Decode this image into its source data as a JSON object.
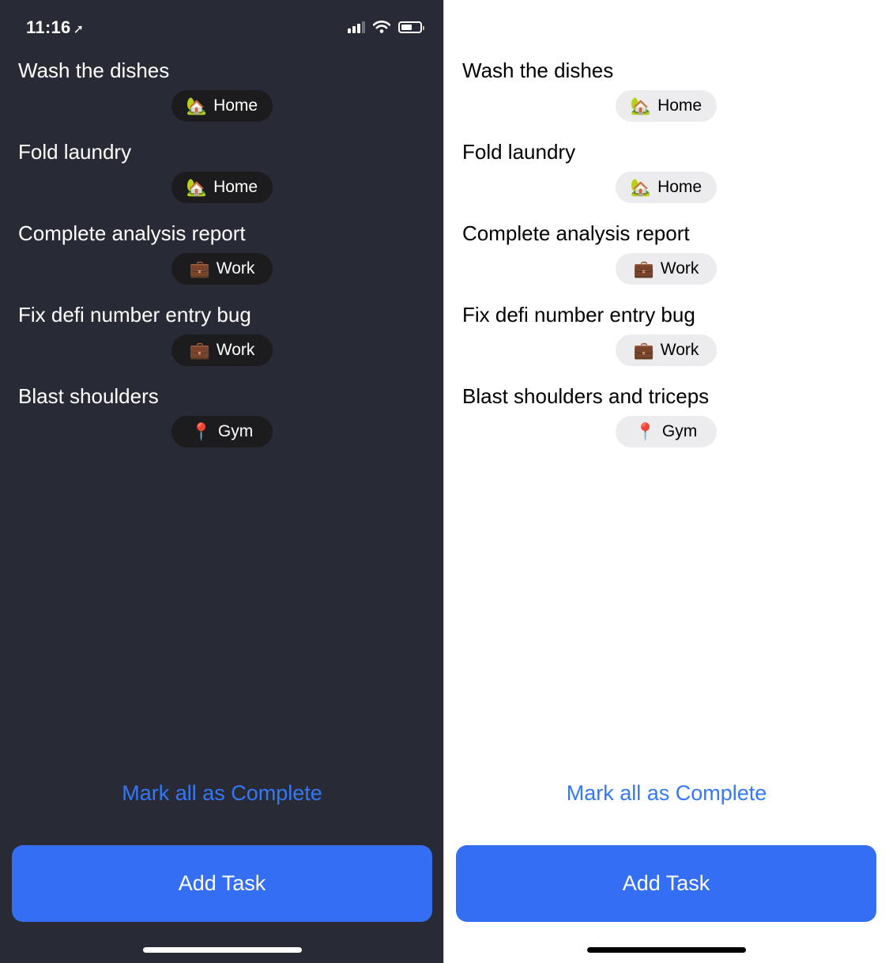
{
  "status_bar": {
    "time": "11:16",
    "location_icon": "location-arrow-icon",
    "signal_icon": "cellular-signal-icon",
    "wifi_icon": "wifi-icon",
    "battery_icon": "battery-icon"
  },
  "screens": [
    {
      "theme": "dark",
      "tasks": [
        {
          "title": "Wash the dishes",
          "tag_emoji": "🏡",
          "tag_label": "Home"
        },
        {
          "title": "Fold laundry",
          "tag_emoji": "🏡",
          "tag_label": "Home"
        },
        {
          "title": "Complete analysis report",
          "tag_emoji": "💼",
          "tag_label": "Work"
        },
        {
          "title": "Fix defi number entry bug",
          "tag_emoji": "💼",
          "tag_label": "Work"
        },
        {
          "title": "Blast shoulders",
          "tag_emoji": "📍",
          "tag_label": "Gym"
        }
      ],
      "mark_all_label": "Mark all as Complete",
      "add_task_label": "Add Task"
    },
    {
      "theme": "light",
      "tasks": [
        {
          "title": "Wash the dishes",
          "tag_emoji": "🏡",
          "tag_label": "Home"
        },
        {
          "title": "Fold laundry",
          "tag_emoji": "🏡",
          "tag_label": "Home"
        },
        {
          "title": "Complete analysis report",
          "tag_emoji": "💼",
          "tag_label": "Work"
        },
        {
          "title": "Fix defi number entry bug",
          "tag_emoji": "💼",
          "tag_label": "Work"
        },
        {
          "title": "Blast shoulders and triceps",
          "tag_emoji": "📍",
          "tag_label": "Gym"
        }
      ],
      "mark_all_label": "Mark all as Complete",
      "add_task_label": "Add Task"
    }
  ],
  "colors": {
    "dark_background": "#282a36",
    "light_background": "#ffffff",
    "accent_blue": "#346ef3",
    "link_blue": "#3478f6"
  }
}
